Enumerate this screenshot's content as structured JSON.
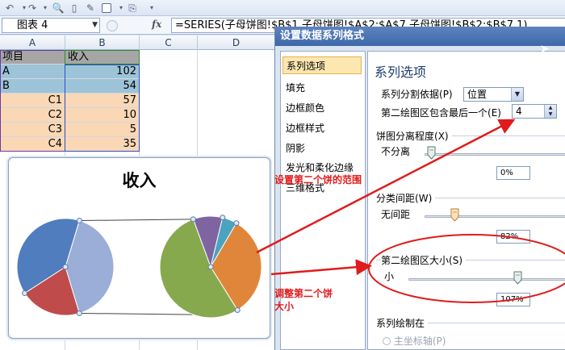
{
  "toolbar": {
    "icons": [
      "undo-icon",
      "redo-icon",
      "print-preview-icon",
      "new-document-icon",
      "paste-format-icon",
      "shape-icon",
      "copy-icon",
      "more-icon"
    ]
  },
  "formula_bar": {
    "name_box": "图表 4",
    "fx_label": "fx",
    "formula": "=SERIES(子母饼图!$B$1,子母饼图!$A$2:$A$7,子母饼图!$B$2:$B$7,1)"
  },
  "sheet": {
    "columns": [
      "A",
      "B",
      "C",
      "D"
    ],
    "rows": [
      {
        "a": "项目",
        "b": "收入"
      },
      {
        "a": "A",
        "b": "102"
      },
      {
        "a": "B",
        "b": "54"
      },
      {
        "a": "C1",
        "b": "57"
      },
      {
        "a": "C2",
        "b": "10"
      },
      {
        "a": "C3",
        "b": "5"
      },
      {
        "a": "C4",
        "b": "35"
      }
    ]
  },
  "chart": {
    "title": "收入",
    "colors": [
      "#4f7dbd",
      "#9aaed7",
      "#bf4b4b",
      "#87a94e",
      "#7e65a1",
      "#4aa4c0",
      "#e0863a"
    ]
  },
  "dialog": {
    "title": "设置数据系列格式",
    "nav": [
      "系列选项",
      "填充",
      "边框颜色",
      "边框样式",
      "阴影",
      "发光和柔化边缘",
      "三维格式"
    ],
    "panel_title": "系列选项",
    "split_by_label": "系列分割依据",
    "split_by_key": "(P)",
    "split_by_value": "位置",
    "second_plot_label": "第二绘图区包含最后一个",
    "second_plot_key": "(E)",
    "second_plot_value": "4",
    "pie_explosion": "饼图分离程度",
    "pie_explosion_key": "(X)",
    "no_separation": "不分离",
    "explosion_value": "0%",
    "gap_width": "分类间距",
    "gap_width_key": "(W)",
    "no_gap": "无间距",
    "gap_value": "82%",
    "second_plot_size": "第二绘图区大小",
    "second_plot_size_key": "(S)",
    "small": "小",
    "size_value": "107%",
    "plot_series_on": "系列绘制在",
    "primary_axis": "主坐标轴",
    "primary_axis_key": "(P)"
  },
  "annotations": {
    "range_note": "设置第二个饼的范围",
    "size_note_line1": "调整第二个饼",
    "size_note_line2": "大小"
  }
}
